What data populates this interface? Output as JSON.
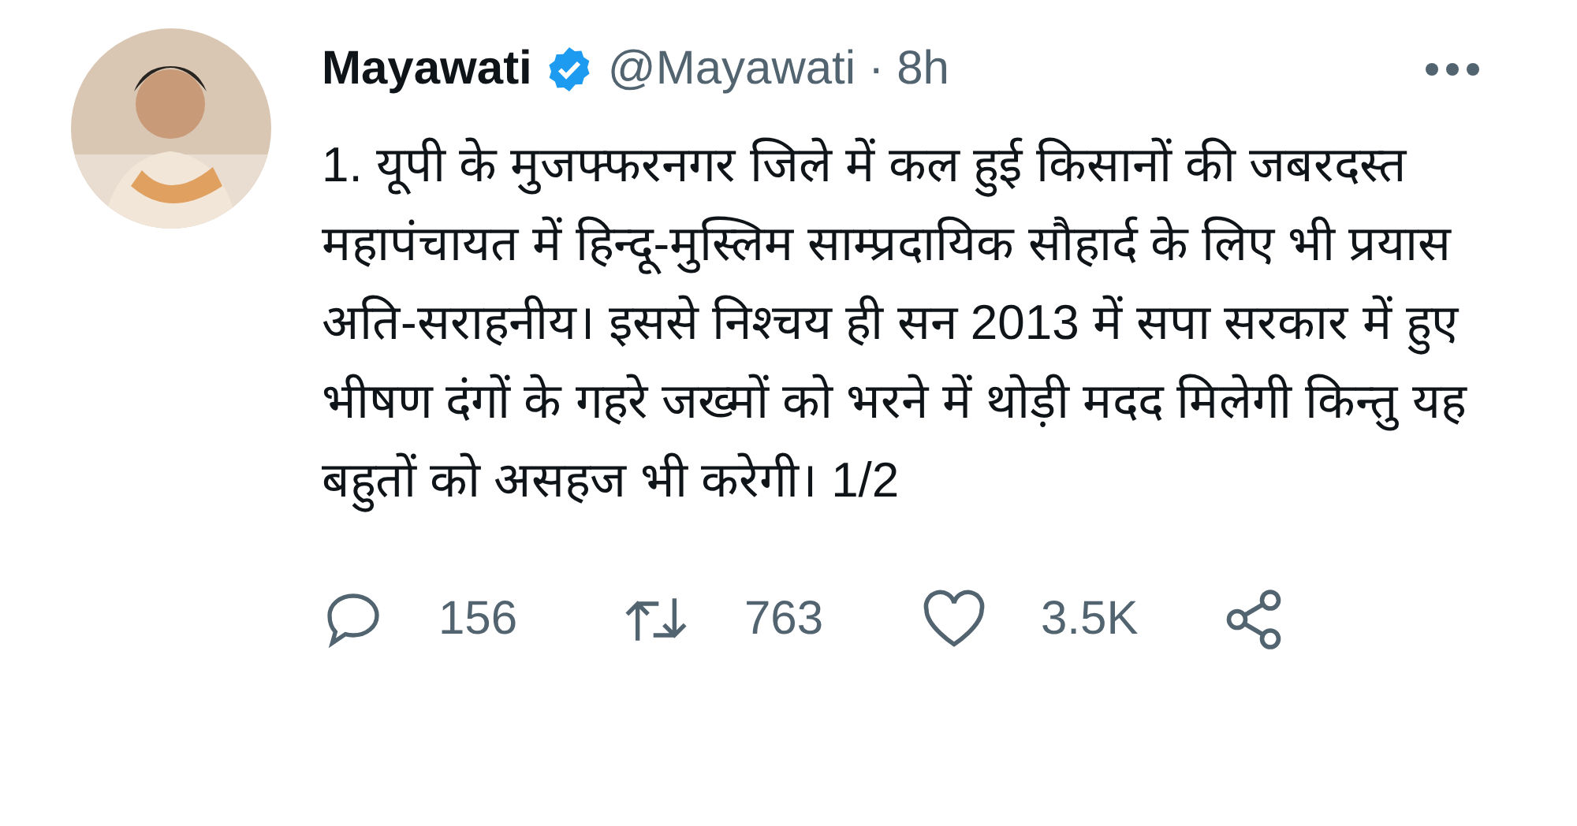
{
  "tweet": {
    "author": {
      "name": "Mayawati",
      "verified": true,
      "handle": "@Mayawati",
      "separator": "·",
      "time": "8h"
    },
    "text": "1. यूपी के मुजफ्फरनगर जिले में कल हुई किसानों की जबरदस्त महापंचायत में हिन्दू-मुस्लिम साम्प्रदायिक सौहार्द के लिए भी प्रयास अति-सराहनीय। इससे निश्चय ही सन 2013 में सपा सरकार में हुए भीषण दंगों के गहरे जख्मों को भरने में थोड़ी मदद मिलेगी किन्तु यह बहुतों को असहज भी करेगी। 1/2",
    "actions": [
      {
        "kind": "reply",
        "count": "156"
      },
      {
        "kind": "retweet",
        "count": "763"
      },
      {
        "kind": "like",
        "count": "3.5K"
      },
      {
        "kind": "share"
      }
    ]
  }
}
